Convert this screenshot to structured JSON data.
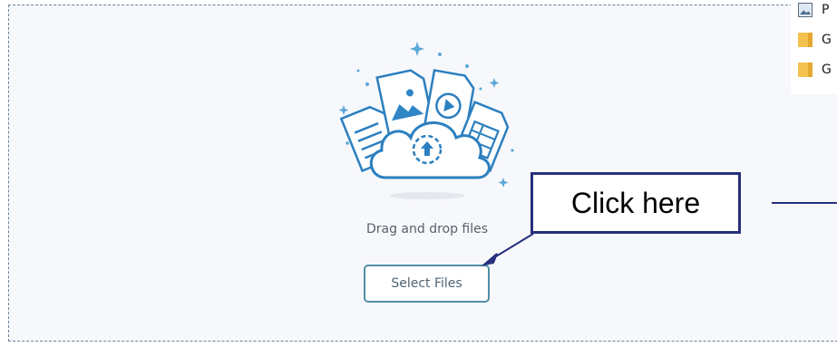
{
  "dropzone": {
    "drag_text": "Drag and drop files",
    "select_button_label": "Select Files"
  },
  "callout": {
    "text": "Click here"
  },
  "file_list": {
    "items": [
      {
        "label": "P",
        "icon": "picture-icon"
      },
      {
        "label": "G",
        "icon": "folder-icon"
      },
      {
        "label": "G",
        "icon": "folder-icon"
      }
    ]
  },
  "colors": {
    "accent": "#4f8fa4",
    "illustration_blue": "#3a8dc5",
    "callout_border": "#26307c",
    "dropzone_border": "#6d8299"
  }
}
